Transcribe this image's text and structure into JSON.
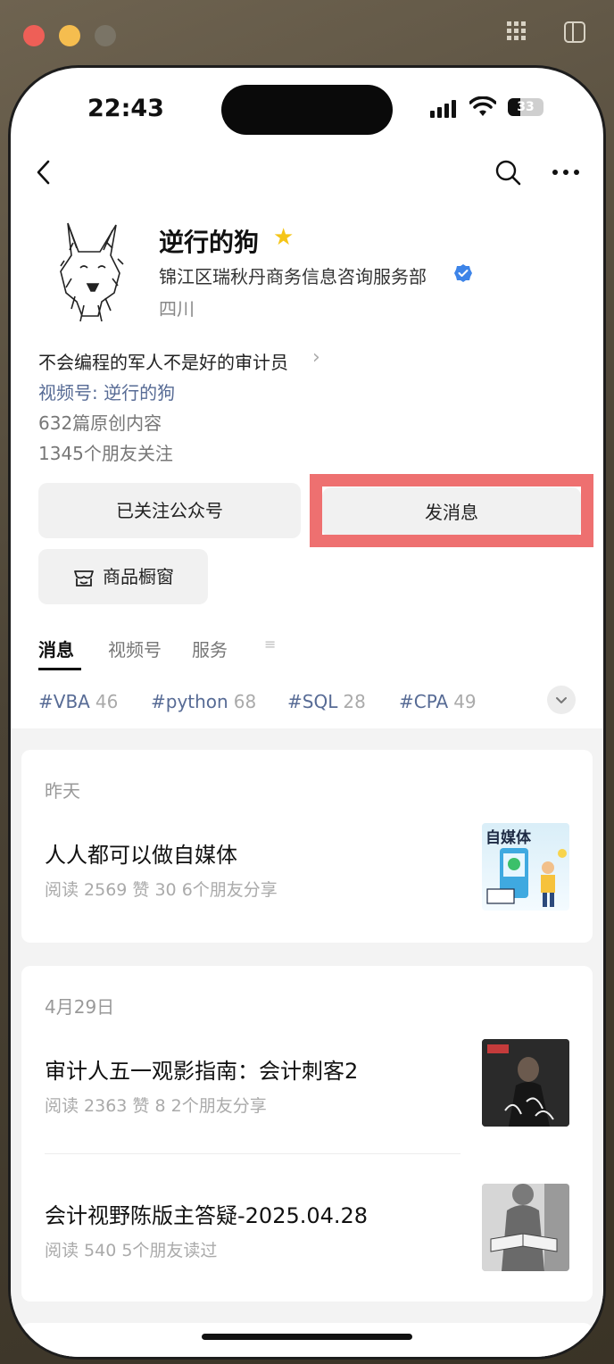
{
  "status": {
    "time": "22:43",
    "battery": "33"
  },
  "profile": {
    "name": "逆行的狗",
    "company": "锦江区瑞秋丹商务信息咨询服务部",
    "region": "四川",
    "bio": "不会编程的军人不是好的审计员",
    "channel": "视频号: 逆行的狗",
    "articles": "632篇原创内容",
    "followers": "1345个朋友关注"
  },
  "actions": {
    "follow_label": "已关注公众号",
    "message_label": "发消息",
    "shop_label": "商品橱窗"
  },
  "tabs": [
    {
      "label": "消息",
      "active": true
    },
    {
      "label": "视频号",
      "active": false
    },
    {
      "label": "服务",
      "active": false
    }
  ],
  "tags": [
    {
      "name": "#VBA",
      "count": "46"
    },
    {
      "name": "#python",
      "count": "68"
    },
    {
      "name": "#SQL",
      "count": "28"
    },
    {
      "name": "#CPA",
      "count": "49"
    }
  ],
  "feed": [
    {
      "date": "昨天",
      "items": [
        {
          "title": "人人都可以做自媒体",
          "meta": "阅读 2569  赞 30  6个朋友分享",
          "thumb_text": "自媒体"
        }
      ]
    },
    {
      "date": "4月29日",
      "items": [
        {
          "title": "审计人五一观影指南：会计刺客2",
          "meta": "阅读 2363  赞 8  2个朋友分享",
          "thumb_text": ""
        },
        {
          "title": "会计视野陈版主答疑-2025.04.28",
          "meta": "阅读 540  5个朋友读过",
          "thumb_text": ""
        }
      ]
    }
  ],
  "colors": {
    "link": "#576b95",
    "highlight": "#ee7070",
    "star": "#f5c518",
    "verify": "#3d84e8"
  }
}
